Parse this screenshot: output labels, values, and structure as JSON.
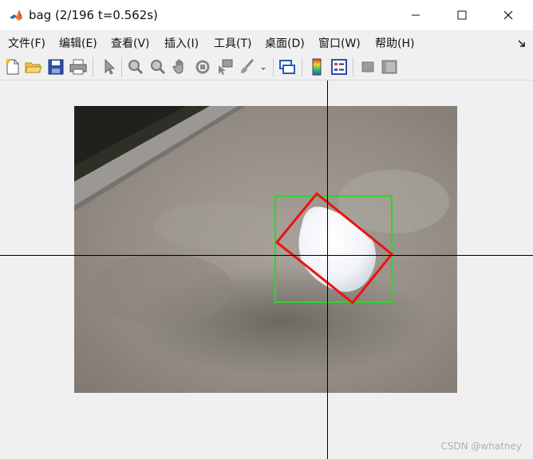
{
  "window": {
    "title": "bag (2/196 t=0.562s)",
    "icon": "matlab-logo-icon",
    "controls": [
      "minimize-icon",
      "maximize-icon",
      "close-icon"
    ]
  },
  "menu": {
    "items": [
      {
        "label": "文件(F)"
      },
      {
        "label": "编辑(E)"
      },
      {
        "label": "查看(V)"
      },
      {
        "label": "插入(I)"
      },
      {
        "label": "工具(T)"
      },
      {
        "label": "桌面(D)"
      },
      {
        "label": "窗口(W)"
      },
      {
        "label": "帮助(H)"
      }
    ]
  },
  "toolbar": {
    "icons": [
      "new-figure-icon",
      "open-file-icon",
      "save-icon",
      "print-icon",
      "edit-plot-icon",
      "zoom-in-icon",
      "zoom-out-icon",
      "pan-icon",
      "rotate-3d-icon",
      "data-cursor-icon",
      "brush-icon",
      "brush-dropdown-icon",
      "link-plot-icon",
      "colorbar-icon",
      "legend-icon",
      "hide-plot-tools-icon",
      "show-plot-tools-icon"
    ]
  },
  "overlay": {
    "axis_aligned_box_color": "#22dd22",
    "rotated_box_color": "#ee1111",
    "crosshair_color": "#000000"
  },
  "watermark": "CSDN @whatney"
}
